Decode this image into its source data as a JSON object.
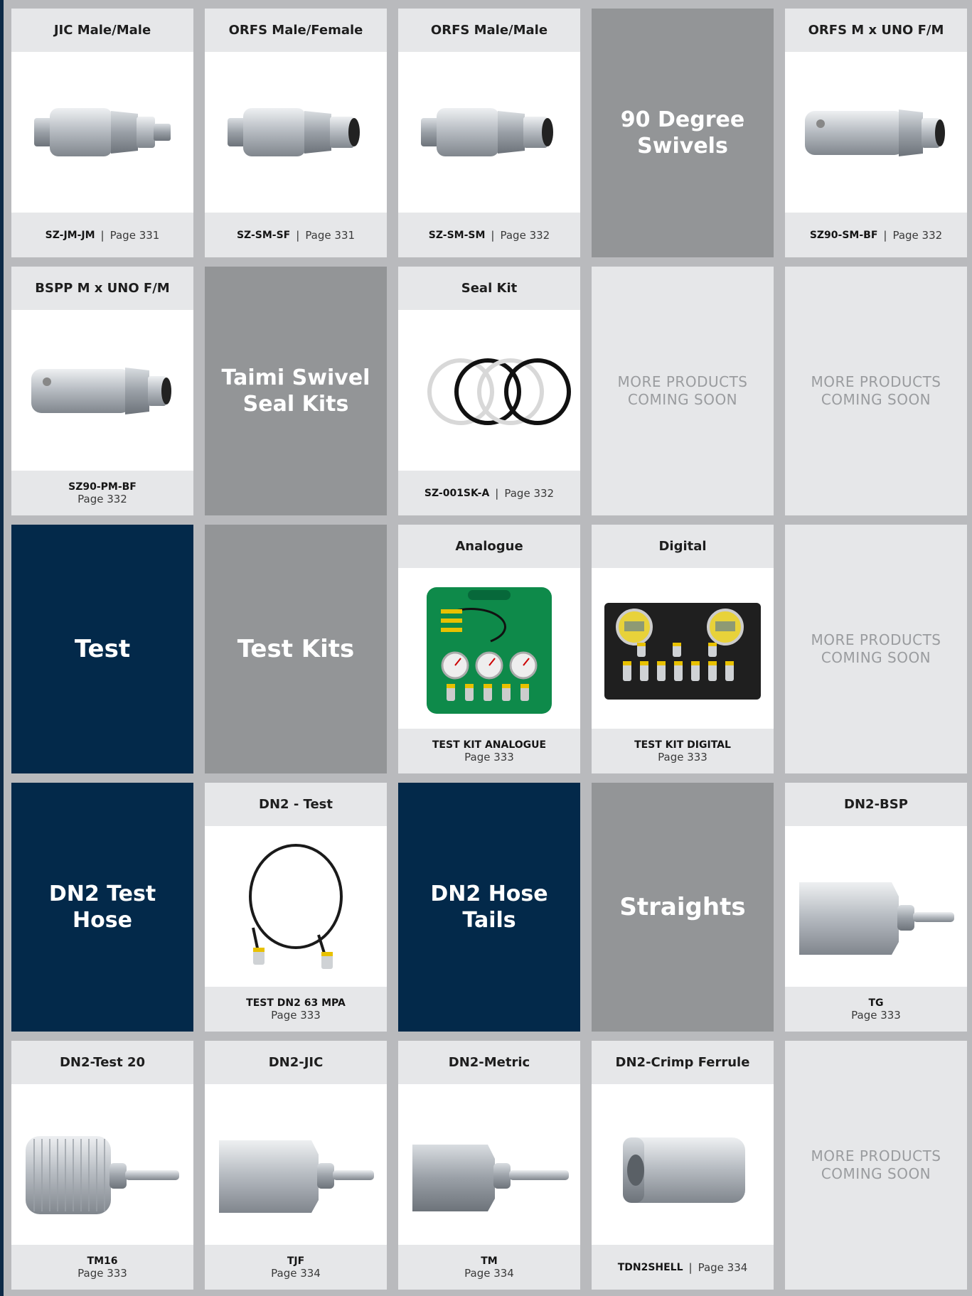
{
  "rows": [
    [
      {
        "type": "product",
        "title": "JIC Male/Male",
        "code": "SZ-JM-JM",
        "page": "Page 331",
        "layout": "inline",
        "icon": "swivel-jic-icon"
      },
      {
        "type": "product",
        "title": "ORFS Male/Female",
        "code": "SZ-SM-SF",
        "page": "Page 331",
        "layout": "inline",
        "icon": "swivel-orfs-mf-icon"
      },
      {
        "type": "product",
        "title": "ORFS Male/Male",
        "code": "SZ-SM-SM",
        "page": "Page 332",
        "layout": "inline",
        "icon": "swivel-orfs-mm-icon"
      },
      {
        "type": "category",
        "title": "90 Degree Swivels",
        "color": "grey"
      },
      {
        "type": "product",
        "title": "ORFS M x UNO F/M",
        "code": "SZ90-SM-BF",
        "page": "Page 332",
        "layout": "inline",
        "icon": "swivel-90-orfs-icon"
      }
    ],
    [
      {
        "type": "product",
        "title": "BSPP M x UNO F/M",
        "code": "SZ90-PM-BF",
        "page": "Page 332",
        "layout": "stacked",
        "icon": "swivel-90-bspp-icon"
      },
      {
        "type": "category",
        "title": "Taimi Swivel Seal Kits",
        "color": "grey"
      },
      {
        "type": "product",
        "title": "Seal Kit",
        "code": "SZ-001SK-A",
        "page": "Page 332",
        "layout": "inline",
        "icon": "seal-rings-icon"
      },
      {
        "type": "soon",
        "text": "MORE PRODUCTS COMING SOON"
      },
      {
        "type": "soon",
        "text": "MORE PRODUCTS COMING SOON"
      }
    ],
    [
      {
        "type": "category",
        "title": "Test",
        "color": "navy"
      },
      {
        "type": "category",
        "title": "Test Kits",
        "color": "grey"
      },
      {
        "type": "product",
        "title": "Analogue",
        "code": "TEST KIT ANALOGUE",
        "page": "Page 333",
        "layout": "stacked",
        "icon": "test-kit-analogue-icon"
      },
      {
        "type": "product",
        "title": "Digital",
        "code": "TEST KIT DIGITAL",
        "page": "Page 333",
        "layout": "stacked",
        "icon": "test-kit-digital-icon"
      },
      {
        "type": "soon",
        "text": "MORE PRODUCTS COMING SOON"
      }
    ],
    [
      {
        "type": "category",
        "title": "DN2 Test Hose",
        "color": "navy"
      },
      {
        "type": "product",
        "title": "DN2 - Test",
        "code": "TEST DN2 63 MPA",
        "page": "Page 333",
        "layout": "stacked",
        "icon": "test-hose-icon"
      },
      {
        "type": "category",
        "title": "DN2 Hose Tails",
        "color": "navy"
      },
      {
        "type": "category",
        "title": "Straights",
        "color": "grey"
      },
      {
        "type": "product",
        "title": "DN2-BSP",
        "code": "TG",
        "page": "Page 333",
        "layout": "stacked",
        "icon": "hose-tail-bsp-icon"
      }
    ],
    [
      {
        "type": "product",
        "title": "DN2-Test 20",
        "code": "TM16",
        "page": "Page 333",
        "layout": "stacked",
        "icon": "hose-tail-test20-icon"
      },
      {
        "type": "product",
        "title": "DN2-JIC",
        "code": "TJF",
        "page": "Page 334",
        "layout": "stacked",
        "icon": "hose-tail-jic-icon"
      },
      {
        "type": "product",
        "title": "DN2-Metric",
        "code": "TM",
        "page": "Page 334",
        "layout": "stacked",
        "icon": "hose-tail-metric-icon"
      },
      {
        "type": "product",
        "title": "DN2-Crimp Ferrule",
        "code": "TDN2SHELL",
        "page": "Page 334",
        "layout": "inline",
        "icon": "crimp-ferrule-icon"
      },
      {
        "type": "soon",
        "text": "MORE PRODUCTS COMING SOON"
      }
    ]
  ],
  "colors": {
    "navy": "#03294a",
    "grey": "#939597",
    "soon_bg": "#e6e7e9",
    "soon_text": "#9a9c9f",
    "gutter": "#b9babd"
  }
}
